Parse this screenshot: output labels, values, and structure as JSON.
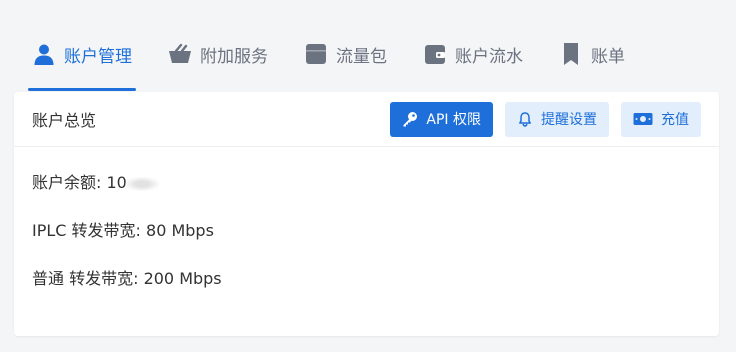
{
  "tabs": [
    {
      "label": "账户管理",
      "icon": "user-icon",
      "active": true
    },
    {
      "label": "附加服务",
      "icon": "basket-icon",
      "active": false
    },
    {
      "label": "流量包",
      "icon": "box-icon",
      "active": false
    },
    {
      "label": "账户流水",
      "icon": "wallet-icon",
      "active": false
    },
    {
      "label": "账单",
      "icon": "bookmark-icon",
      "active": false
    }
  ],
  "card": {
    "title": "账户总览",
    "buttons": {
      "api": {
        "label": "API 权限",
        "icon": "key-icon"
      },
      "reminder": {
        "label": "提醒设置",
        "icon": "bell-icon"
      },
      "recharge": {
        "label": "充值",
        "icon": "money-icon"
      }
    },
    "balance_label": "账户余额: ",
    "balance_value": "10",
    "iplc_bandwidth": "IPLC 转发带宽: 80 Mbps",
    "normal_bandwidth": "普通 转发带宽: 200 Mbps"
  },
  "colors": {
    "accent": "#1e6fd9",
    "tab_inactive": "#6b7280",
    "light_button_bg": "#e3eefc",
    "page_bg": "#f4f5f7"
  }
}
